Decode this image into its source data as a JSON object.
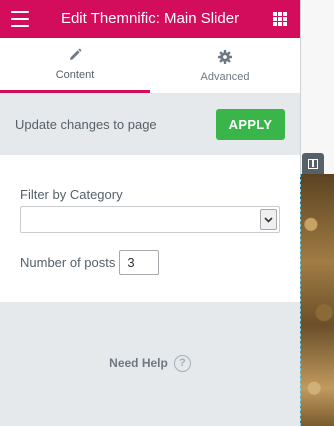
{
  "header": {
    "title": "Edit Themnific: Main Slider",
    "menu_icon": "hamburger-icon",
    "apps_icon": "grid-icon"
  },
  "tabs": [
    {
      "label": "Content",
      "icon": "pencil-icon",
      "active": true
    },
    {
      "label": "Advanced",
      "icon": "gear-icon",
      "active": false
    }
  ],
  "apply": {
    "text": "Update changes to page",
    "button_label": "APPLY"
  },
  "controls": {
    "category_label": "Filter by Category",
    "category_value": "",
    "posts_label": "Number of posts",
    "posts_value": "3"
  },
  "help": {
    "label": "Need Help",
    "icon": "question-circle-icon"
  },
  "colors": {
    "brand": "#d30c5c",
    "apply": "#39b54a",
    "panel_bg": "#e6e9ec"
  }
}
